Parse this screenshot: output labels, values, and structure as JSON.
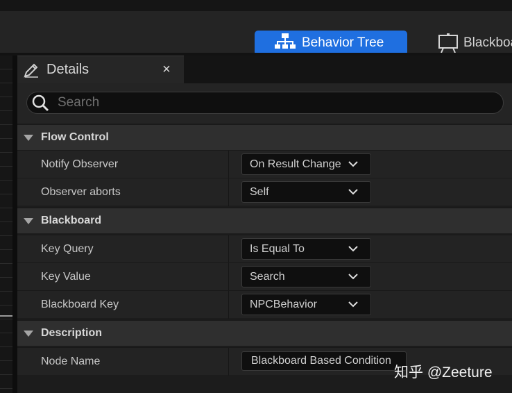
{
  "toolbar": {
    "behavior_tree_tab": "Behavior Tree",
    "blackboard_tab": "Blackboard"
  },
  "details": {
    "title": "Details",
    "close_glyph": "×",
    "search": {
      "placeholder": "Search",
      "value": ""
    }
  },
  "sections": [
    {
      "label": "Flow Control",
      "properties": [
        {
          "label": "Notify Observer",
          "value": "On Result Change",
          "widget": "dropdown"
        },
        {
          "label": "Observer aborts",
          "value": "Self",
          "widget": "dropdown"
        }
      ]
    },
    {
      "label": "Blackboard",
      "properties": [
        {
          "label": "Key Query",
          "value": "Is Equal To",
          "widget": "dropdown"
        },
        {
          "label": "Key Value",
          "value": "Search",
          "widget": "dropdown"
        },
        {
          "label": "Blackboard Key",
          "value": "NPCBehavior",
          "widget": "dropdown"
        }
      ]
    },
    {
      "label": "Description",
      "properties": [
        {
          "label": "Node Name",
          "value": "Blackboard Based Condition",
          "widget": "text"
        }
      ]
    }
  ],
  "watermark": "知乎 @Zeeture",
  "icons": {
    "behavior_tree": "behavior-tree-icon",
    "blackboard": "blackboard-icon",
    "details": "details-pencil-icon",
    "search": "search-icon",
    "section_arrow": "triangle-down-icon",
    "dropdown": "chevron-down-icon"
  },
  "colors": {
    "accent": "#1f6fe0",
    "panel": "#232323",
    "section": "#2f2f2f",
    "field": "#0f0f0f"
  }
}
